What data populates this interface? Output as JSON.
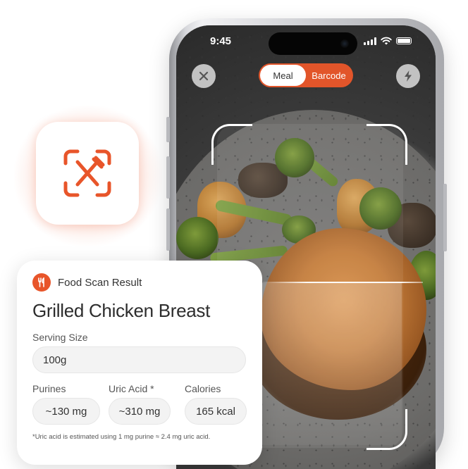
{
  "status_bar": {
    "time": "9:45"
  },
  "camera": {
    "modes": [
      {
        "label": "Meal",
        "active": true
      },
      {
        "label": "Barcode",
        "active": false
      }
    ],
    "close_icon": "close-icon",
    "flash_icon": "flash-icon"
  },
  "app_icon": {
    "icon": "scan-utensils-icon",
    "accent": "#E8552A"
  },
  "result_card": {
    "header": "Food Scan Result",
    "food_name": "Grilled Chicken Breast",
    "serving_size": {
      "label": "Serving Size",
      "value": "100g"
    },
    "metrics": [
      {
        "label": "Purines",
        "value": "~130 mg"
      },
      {
        "label": "Uric Acid *",
        "value": "~310 mg"
      },
      {
        "label": "Calories",
        "value": "165 kcal"
      }
    ],
    "footnote": "*Uric acid is estimated using 1 mg purine ≈ 2.4 mg uric acid."
  },
  "colors": {
    "accent": "#E8552A",
    "card_bg": "#FFFFFF",
    "pill_bg": "#F3F3F3"
  }
}
